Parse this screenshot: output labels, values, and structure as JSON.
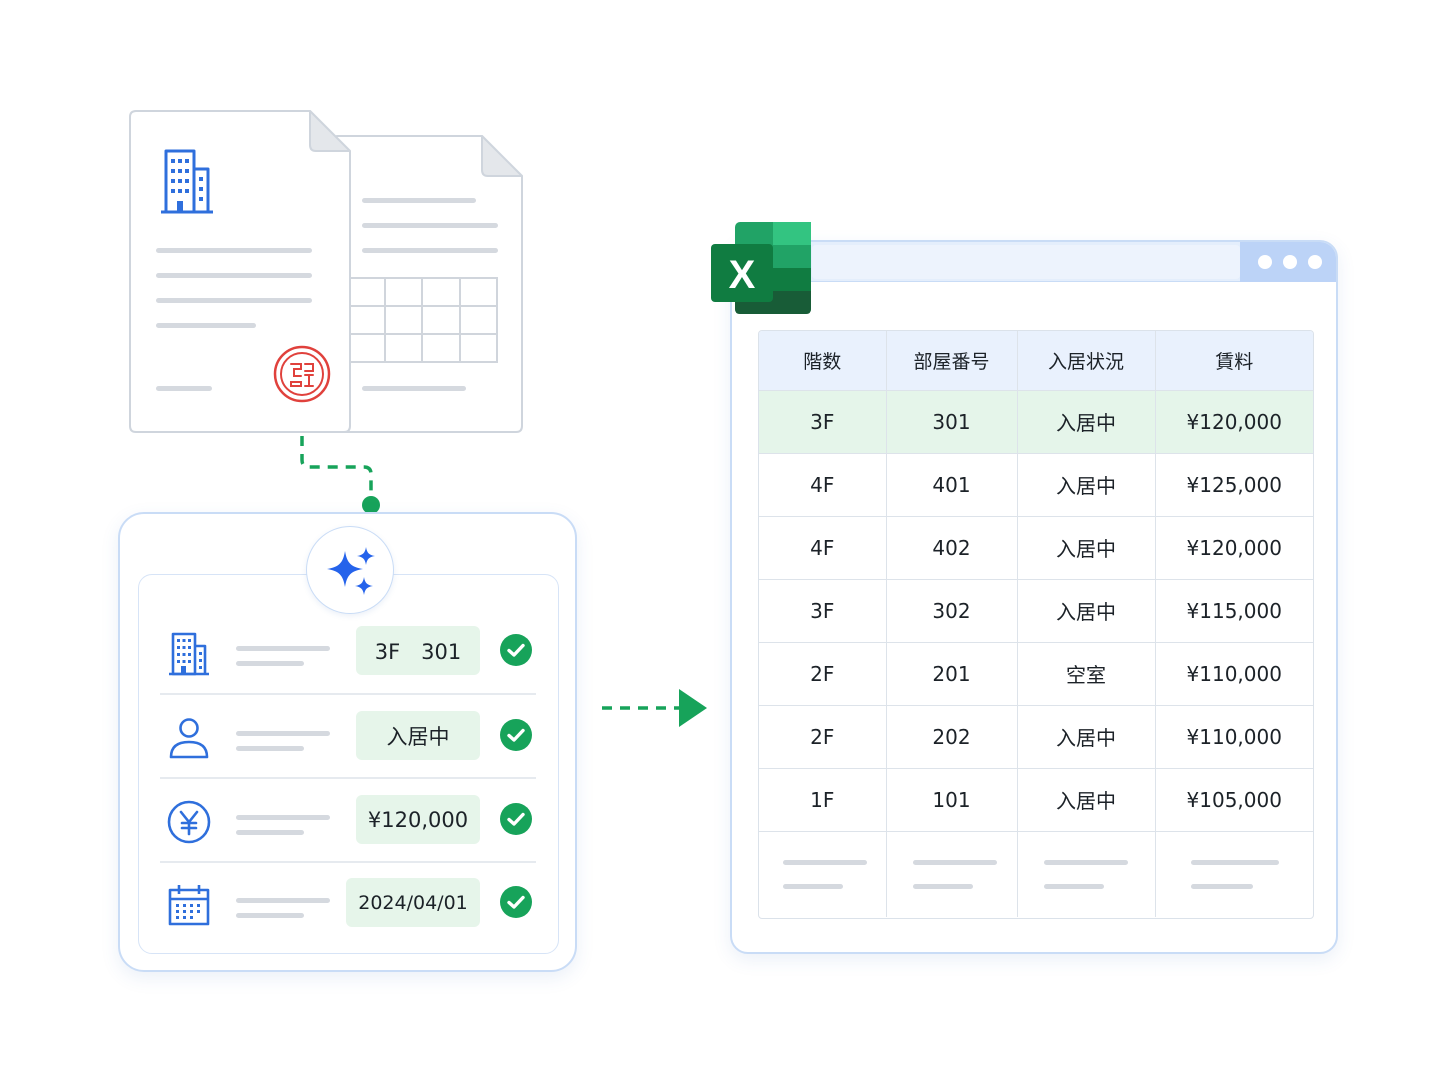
{
  "extraction": {
    "rows": [
      {
        "icon": "building-icon",
        "value": "3F　301"
      },
      {
        "icon": "person-icon",
        "value": "入居中"
      },
      {
        "icon": "yen-icon",
        "value": "¥120,000"
      },
      {
        "icon": "calendar-icon",
        "value": "2024/04/01"
      }
    ],
    "badge_icon": "sparkle-icon",
    "check_icon": "check-circle-icon"
  },
  "spreadsheet": {
    "app_icon": "excel-icon",
    "logo_letter": "X",
    "headers": [
      "階数",
      "部屋番号",
      "入居状況",
      "賃料"
    ],
    "rows": [
      [
        "3F",
        "301",
        "入居中",
        "¥120,000"
      ],
      [
        "4F",
        "401",
        "入居中",
        "¥125,000"
      ],
      [
        "4F",
        "402",
        "入居中",
        "¥120,000"
      ],
      [
        "3F",
        "302",
        "入居中",
        "¥115,000"
      ],
      [
        "2F",
        "201",
        "空室",
        "¥110,000"
      ],
      [
        "2F",
        "202",
        "入居中",
        "¥110,000"
      ],
      [
        "1F",
        "101",
        "入居中",
        "¥105,000"
      ]
    ],
    "highlighted_row": 0
  },
  "colors": {
    "accent_blue": "#2f6fdc",
    "success_green": "#17a35a",
    "stamp_red": "#e0413c",
    "excel_green": "#1f7a45",
    "highlight_green": "#e5f5ea",
    "header_blue": "#e9f1fd"
  }
}
